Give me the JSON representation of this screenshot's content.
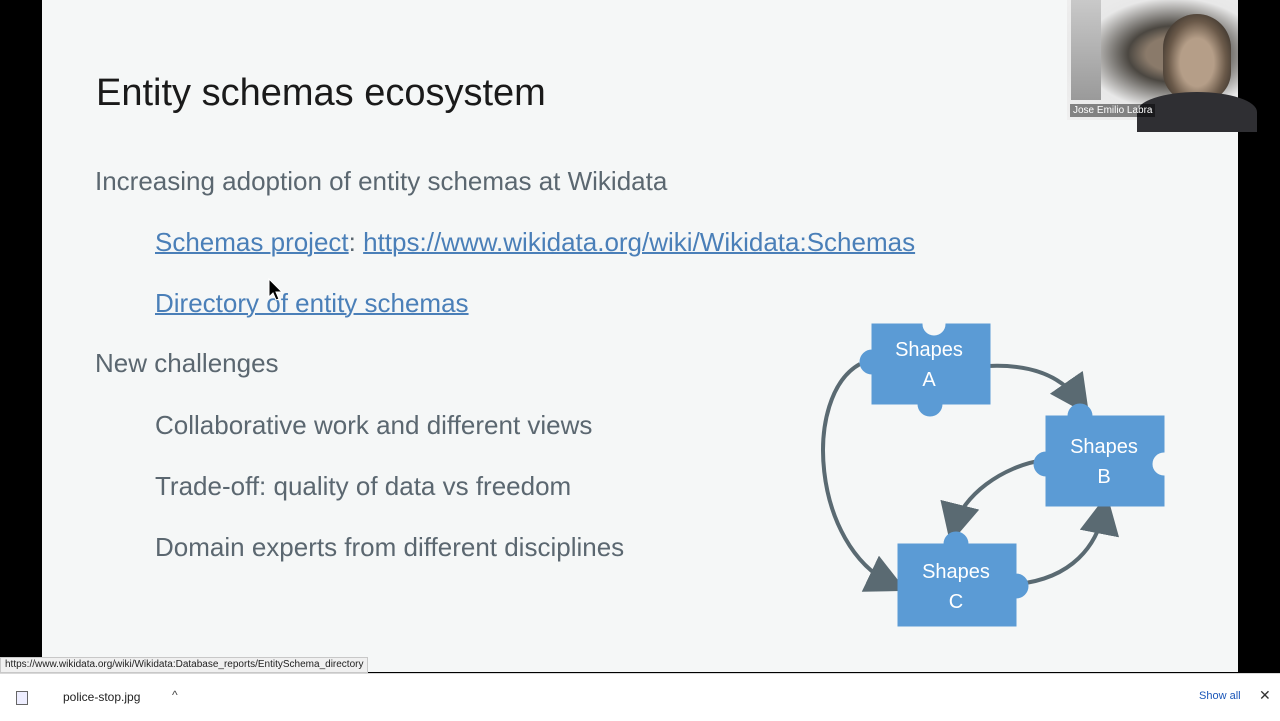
{
  "slide": {
    "title": "Entity schemas ecosystem",
    "bullets": {
      "adoption": "Increasing adoption of entity schemas at Wikidata",
      "schemas_project_link": "Schemas project",
      "separator": ":",
      "schemas_url_link": "https://www.wikidata.org/wiki/Wikidata:Schemas",
      "directory_link": "Directory of entity schemas",
      "challenges": "New challenges",
      "challenge_1": "Collaborative work and different views",
      "challenge_2": "Trade-off: quality of data vs freedom",
      "challenge_3": "Domain experts from different disciplines"
    },
    "diagram": {
      "piece_a": [
        "Shapes",
        "A"
      ],
      "piece_b": [
        "Shapes",
        "B"
      ],
      "piece_c": [
        "Shapes",
        "C"
      ]
    }
  },
  "webcam": {
    "participant_name": "Jose Emilio Labra"
  },
  "status_bar": {
    "url": "https://www.wikidata.org/wiki/Wikidata:Database_reports/EntitySchema_directory"
  },
  "download_bar": {
    "file_name": "police-stop.jpg",
    "chevron": "^",
    "show_all": "Show all",
    "close": "✕"
  },
  "colors": {
    "piece_fill": "#5b9bd5",
    "link": "#4a7fb8",
    "text": "#5b6770"
  }
}
